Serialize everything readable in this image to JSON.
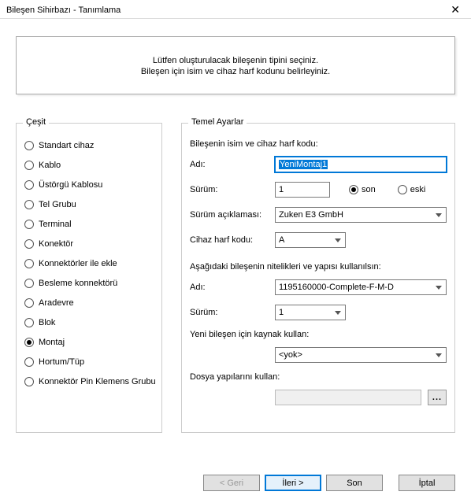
{
  "window": {
    "title": "Bileşen Sihirbazı - Tanımlama"
  },
  "banner": {
    "line1": "Lütfen oluşturulacak bileşenin tipini seçiniz.",
    "line2": "Bileşen için isim ve cihaz harf kodunu belirleyiniz."
  },
  "type_group": {
    "legend": "Çeşit",
    "options": [
      "Standart cihaz",
      "Kablo",
      "Üstörgü Kablosu",
      "Tel Grubu",
      "Terminal",
      "Konektör",
      "Konnektörler ile ekle",
      "Besleme konnektörü",
      "Aradevre",
      "Blok",
      "Montaj",
      "Hortum/Tüp",
      "Konnektör Pin Klemens Grubu"
    ],
    "selected_index": 10
  },
  "settings": {
    "legend": "Temel Ayarlar",
    "intro": "Bileşenin isim ve cihaz harf kodu:",
    "name_label": "Adı:",
    "name_value": "YeniMontaj1",
    "version_label": "Sürüm:",
    "version_value": "1",
    "version_radio_new": "son",
    "version_radio_old": "eski",
    "version_radio_selected": "son",
    "desc_label": "Sürüm açıklaması:",
    "desc_value": "Zuken E3 GmbH",
    "dev_code_label": "Cihaz harf kodu:",
    "dev_code_value": "A",
    "attrs_text": "Aşağıdaki bileşenin nitelikleri ve yapısı kullanılsın:",
    "attr_name_label": "Adı:",
    "attr_name_value": "1195160000-Complete-F-M-D",
    "attr_version_label": "Sürüm:",
    "attr_version_value": "1",
    "source_label": "Yeni bileşen için kaynak kullan:",
    "source_value": "<yok>",
    "file_struct_label": "Dosya yapılarını kullan:",
    "file_struct_value": "",
    "browse": "..."
  },
  "buttons": {
    "back": "< Geri",
    "next": "İleri >",
    "finish": "Son",
    "cancel": "İptal"
  }
}
